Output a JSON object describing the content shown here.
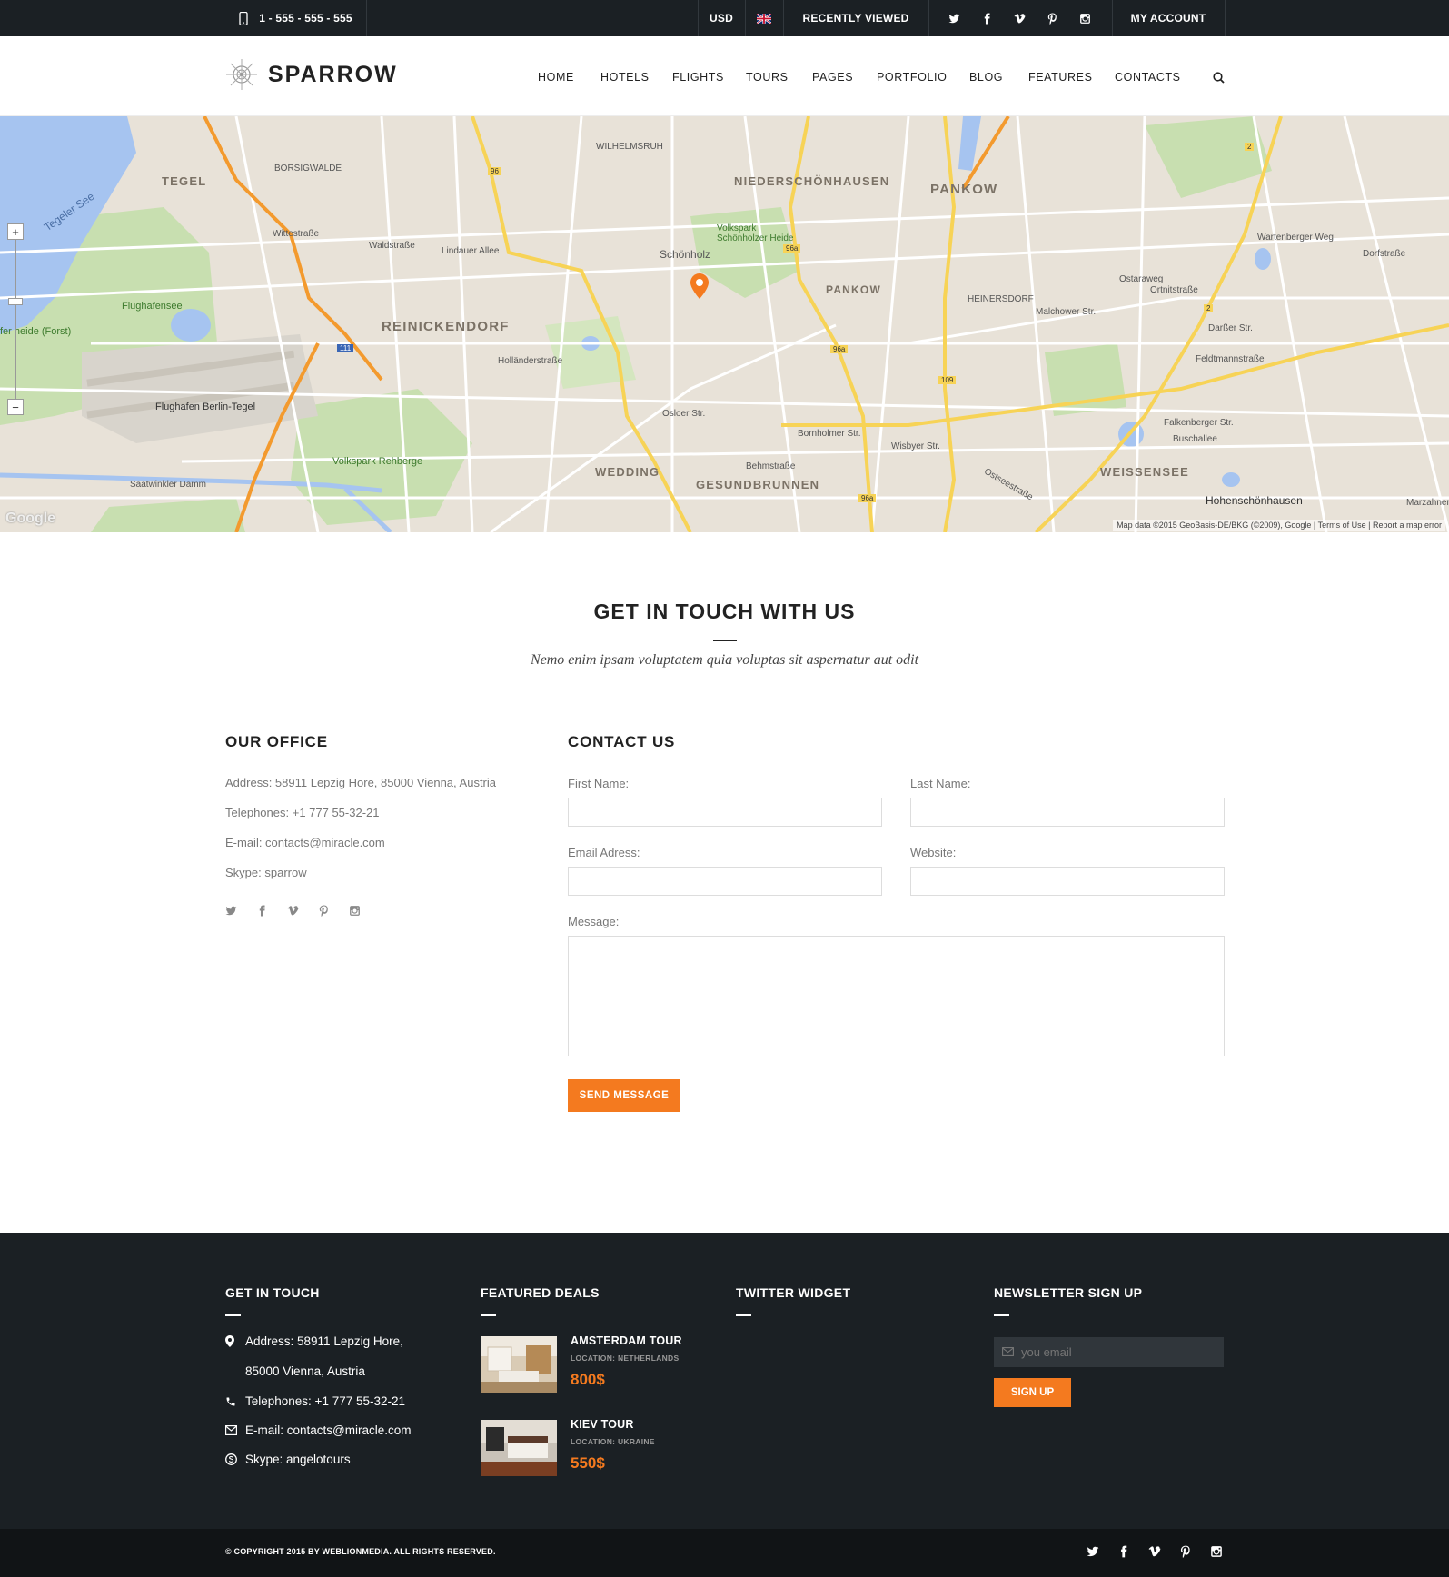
{
  "topbar": {
    "phone": "1 - 555 - 555 - 555",
    "currency": "USD",
    "recently_viewed": "RECENTLY VIEWED",
    "my_account": "MY ACCOUNT"
  },
  "header": {
    "logo": "SPARROW",
    "nav": [
      "HOME",
      "HOTELS",
      "FLIGHTS",
      "TOURS",
      "PAGES",
      "PORTFOLIO",
      "BLOG",
      "FEATURES",
      "CONTACTS"
    ]
  },
  "map": {
    "labels": {
      "tegel": "TEGEL",
      "borsigwalde": "BORSIGWALDE",
      "wilhelmsruh": "WILHELMSRUH",
      "niederschoenhausen": "NIEDERSCHÖNHAUSEN",
      "pankow": "PANKOW",
      "pankow_small": "PANKOW",
      "heinersdorf": "HEINERSDORF",
      "reinickendorf": "REINICKENDORF",
      "wedding": "WEDDING",
      "gesundbrunnen": "GESUNDBRUNNEN",
      "weissensee": "WEISSENSEE",
      "schoenholz": "Schönholz",
      "volkspark_schoenholzer": "Volkspark Schönholzer Heide",
      "flughafensee": "Flughafensee",
      "flughafen": "Flughafen Berlin-Tegel",
      "volkspark_rehberge": "Volkspark Rehberge",
      "hohenschoenhausen": "Hohenschönhausen",
      "tegeler_see": "Tegeler See",
      "forst": "fer heide (Forst)",
      "saatwinkler": "Saatwinkler Damm",
      "osloer": "Osloer Str.",
      "bornholmer": "Bornholmer Str.",
      "behmstr": "Behmstraße",
      "wisbyer": "Wisbyer Str.",
      "malchower": "Malchower Str.",
      "darsser": "Darßer Str.",
      "buschallee": "Buschallee",
      "waldstr": "Waldstraße",
      "lindauer": "Lindauer Allee",
      "wittestr": "Wittestraße",
      "hollaender": "Holländerstraße",
      "ostseestr": "Ostseestraße",
      "falkenberger": "Falkenberger Str.",
      "feldtmann": "Feldtmannstraße",
      "marzahner": "Marzahner",
      "dorfstr": "Dorfstraße",
      "wartenberger": "Wartenberger Weg",
      "ortnitz": "Ortnitstraße",
      "ostaraweg": "Ostaraweg"
    },
    "route_badges": [
      "96",
      "96a",
      "96a",
      "96a",
      "109",
      "111",
      "2",
      "2"
    ],
    "zoom_in": "+",
    "zoom_out": "−",
    "google": "Google",
    "attribution": "Map data ©2015 GeoBasis-DE/BKG (©2009), Google   |   Terms of Use   |   Report a map error"
  },
  "get_in_touch": {
    "title": "GET IN TOUCH WITH US",
    "subtitle": "Nemo enim ipsam voluptatem quia voluptas sit aspernatur aut odit"
  },
  "office": {
    "title": "OUR OFFICE",
    "address": "Address: 58911 Lepzig Hore, 85000 Vienna, Austria",
    "telephones": "Telephones: +1 777 55-32-21",
    "email": "E-mail: contacts@miracle.com",
    "skype": "Skype: sparrow"
  },
  "contact_form": {
    "title": "CONTACT US",
    "first_name": "First Name:",
    "last_name": "Last Name:",
    "email": "Email Adress:",
    "website": "Website:",
    "message": "Message:",
    "submit": "SEND MESSAGE"
  },
  "footer": {
    "get_in_touch": {
      "title": "GET IN TOUCH",
      "address_1": "Address: 58911 Lepzig Hore,",
      "address_2": "85000 Vienna, Austria",
      "telephones": "Telephones: +1 777 55-32-21",
      "email": "E-mail: contacts@miracle.com",
      "skype": "Skype: angelotours"
    },
    "featured_deals": {
      "title": "FEATURED DEALS",
      "deals": [
        {
          "title": "AMSTERDAM TOUR",
          "location": "LOCATION: NETHERLANDS",
          "price": "800$"
        },
        {
          "title": "KIEV TOUR",
          "location": "LOCATION: UKRAINE",
          "price": "550$"
        }
      ]
    },
    "twitter": {
      "title": "TWITTER WIDGET"
    },
    "newsletter": {
      "title": "NEWSLETTER SIGN UP",
      "placeholder": "you email",
      "button": "SIGN UP"
    },
    "copyright": "© COPYRIGHT 2015 BY WEBLIONMEDIA. ALL RIGHTS RESERVED."
  },
  "colors": {
    "accent": "#f47a1f",
    "dark": "#1b2024",
    "darker": "#111416"
  },
  "icons": [
    "phone-icon",
    "uk-flag-icon",
    "twitter-icon",
    "facebook-icon",
    "vimeo-icon",
    "pinterest-icon",
    "instagram-icon",
    "search-icon",
    "map-marker-icon",
    "phone-handset-icon",
    "envelope-icon",
    "skype-icon"
  ]
}
